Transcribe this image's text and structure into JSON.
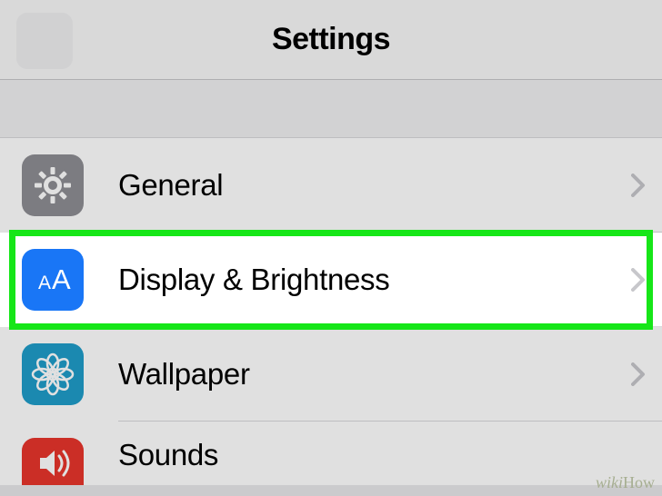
{
  "header": {
    "title": "Settings"
  },
  "rows": {
    "general": {
      "label": "General"
    },
    "display": {
      "label": "Display & Brightness"
    },
    "wallpaper": {
      "label": "Wallpaper"
    },
    "sounds": {
      "label": "Sounds"
    }
  },
  "watermark": {
    "part1": "wiki",
    "part2": "How"
  }
}
